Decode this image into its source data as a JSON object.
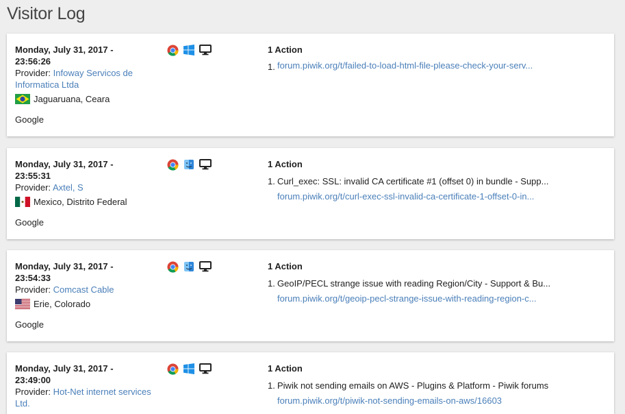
{
  "page_title": "Visitor Log",
  "visits": [
    {
      "date": "Monday, July 31, 2017 -",
      "time": "23:56:26",
      "provider_label": "Provider:",
      "provider": "Infoway Servicos de Informatica Ltda",
      "flag": "brazil",
      "location": "Jaguaruana, Ceara",
      "referrer": "Google",
      "browser_icon": "chrome-icon",
      "os_icon": "windows-icon",
      "device_icon": "desktop-icon",
      "actions_count": "1 Action",
      "actions": [
        {
          "num": "1.",
          "title": "",
          "url": "forum.piwik.org/t/failed-to-load-html-file-please-check-your-serv..."
        }
      ]
    },
    {
      "date": "Monday, July 31, 2017 -",
      "time": "23:55:31",
      "provider_label": "Provider:",
      "provider": "Axtel, S",
      "flag": "mexico",
      "location": "Mexico, Distrito Federal",
      "referrer": "Google",
      "browser_icon": "chrome-icon",
      "os_icon": "mac-finder-icon",
      "device_icon": "desktop-icon",
      "actions_count": "1 Action",
      "actions": [
        {
          "num": "1.",
          "title": "Curl_exec: SSL: invalid CA certificate #1 (offset 0) in bundle - Supp...",
          "url": "forum.piwik.org/t/curl-exec-ssl-invalid-ca-certificate-1-offset-0-in..."
        }
      ]
    },
    {
      "date": "Monday, July 31, 2017 -",
      "time": "23:54:33",
      "provider_label": "Provider:",
      "provider": "Comcast Cable",
      "flag": "usa",
      "location": "Erie, Colorado",
      "referrer": "Google",
      "browser_icon": "chrome-icon",
      "os_icon": "mac-finder-icon",
      "device_icon": "desktop-icon",
      "actions_count": "1 Action",
      "actions": [
        {
          "num": "1.",
          "title": "GeoIP/PECL strange issue with reading Region/City - Support & Bu...",
          "url": "forum.piwik.org/t/geoip-pecl-strange-issue-with-reading-region-c..."
        }
      ]
    },
    {
      "date": "Monday, July 31, 2017 -",
      "time": "23:49:00",
      "provider_label": "Provider:",
      "provider": "Hot-Net internet services Ltd.",
      "flag": "",
      "location": "",
      "referrer": "",
      "browser_icon": "chrome-icon",
      "os_icon": "windows-icon",
      "device_icon": "desktop-icon",
      "actions_count": "1 Action",
      "actions": [
        {
          "num": "1.",
          "title": "Piwik not sending emails on AWS - Plugins & Platform - Piwik forums",
          "url": "forum.piwik.org/t/piwik-not-sending-emails-on-aws/16603"
        }
      ]
    }
  ]
}
